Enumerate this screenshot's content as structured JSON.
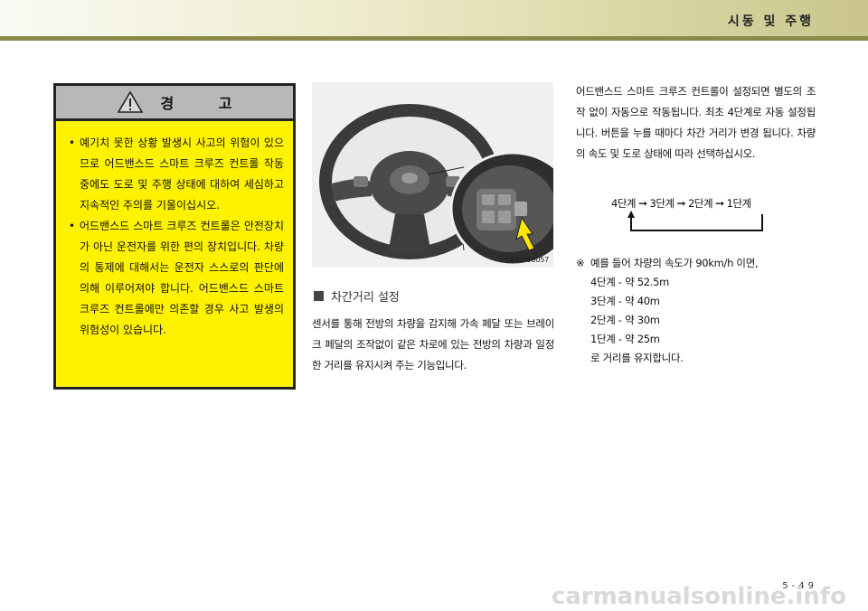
{
  "header": {
    "section_title": "시동 및 주행"
  },
  "warning": {
    "title": "경 고",
    "icon": "warning-triangle-icon",
    "items": [
      "예기치 못한 상황 발생시 사고의 위험이 있으므로 어드밴스드 스마트 크루즈 컨트롤 작동중에도 도로 및 주행 상태에 대하여 세심하고 지속적인 주의를 기울이십시오.",
      "어드밴스드 스마트 크루즈 컨트롤은 안전장치가 아닌 운전자를 위한 편의 장치입니다. 차량의 통제에 대해서는 운전자 스스로의 판단에 의해 이루어져야 합니다. 어드밴스드 스마트 크루즈 컨트롤에만 의존할 경우 사고 발생의 위험성이 있습니다."
    ]
  },
  "photo": {
    "code": "OHG050057"
  },
  "distance_setting": {
    "heading": "차간거리 설정",
    "body": "센서를 통해 전방의 차량을 감지해 가속 페달 또는 브레이크 페달의 조작없이 같은 차로에 있는 전방의 차량과 일정한 거리를 유지시켜 주는 기능입니다."
  },
  "right_column": {
    "paragraph": "어드밴스드 스마트 크루즈 컨트롤이 설정되면 별도의 조작 없이 자동으로 작동됩니다. 최초 4단계로 자동 설정됩니다. 버튼을 누를 때마다 차간 거리가 변경 됩니다. 차량의 속도 및 도로 상태에 따라 선택하십시오.",
    "stages": [
      "4단계",
      "3단계",
      "2단계",
      "1단계"
    ],
    "arrow_glyph": "➞",
    "note_mark": "※",
    "note_intro": "예를 들어 차량의 속도가 90km/h 이면,",
    "note_details": [
      "4단계 - 약 52.5m",
      "3단계 - 약 40m",
      "2단계 - 약 30m",
      "1단계 - 약 25m",
      "로 거리를 유지합니다."
    ]
  },
  "footer": {
    "page_number": "5-49",
    "watermark": "carmanualsonline.info"
  }
}
